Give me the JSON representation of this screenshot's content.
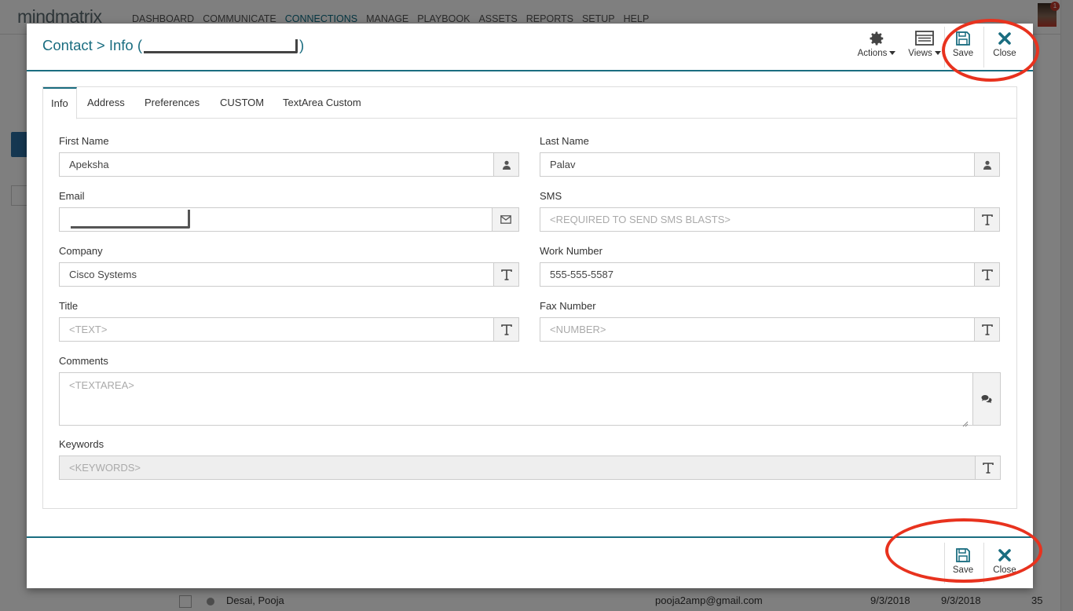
{
  "background": {
    "logo": "mindmatrix",
    "nav": [
      "DASHBOARD",
      "COMMUNICATE",
      "CONNECTIONS",
      "MANAGE",
      "PLAYBOOK",
      "ASSETS",
      "REPORTS",
      "SETUP",
      "HELP"
    ],
    "active_nav": "CONNECTIONS",
    "notification_count": "1",
    "row": {
      "name": "Desai, Pooja",
      "email": "pooja2amp@gmail.com",
      "date1": "9/3/2018",
      "date2": "9/3/2018",
      "value": "35"
    }
  },
  "modal": {
    "title_prefix": "Contact > Info (",
    "title_suffix": ")",
    "header_buttons": {
      "actions": "Actions",
      "views": "Views",
      "save": "Save",
      "close": "Close"
    },
    "tabs": [
      "Info",
      "Address",
      "Preferences",
      "CUSTOM",
      "TextArea Custom"
    ],
    "active_tab": "Info",
    "fields": {
      "first_name": {
        "label": "First Name",
        "value": "Apeksha"
      },
      "last_name": {
        "label": "Last Name",
        "value": "Palav"
      },
      "email": {
        "label": "Email",
        "value": ""
      },
      "sms": {
        "label": "SMS",
        "placeholder": "<REQUIRED TO SEND SMS BLASTS>"
      },
      "company": {
        "label": "Company",
        "value": "Cisco Systems"
      },
      "work_number": {
        "label": "Work Number",
        "value": "555-555-5587"
      },
      "title": {
        "label": "Title",
        "placeholder": "<TEXT>"
      },
      "fax_number": {
        "label": "Fax Number",
        "placeholder": "<NUMBER>"
      },
      "comments": {
        "label": "Comments",
        "placeholder": "<TEXTAREA>"
      },
      "keywords": {
        "label": "Keywords",
        "placeholder": "<KEYWORDS>"
      }
    },
    "footer_buttons": {
      "save": "Save",
      "close": "Close"
    }
  },
  "colors": {
    "accent": "#1a6d80",
    "annotation": "#e8321e"
  }
}
